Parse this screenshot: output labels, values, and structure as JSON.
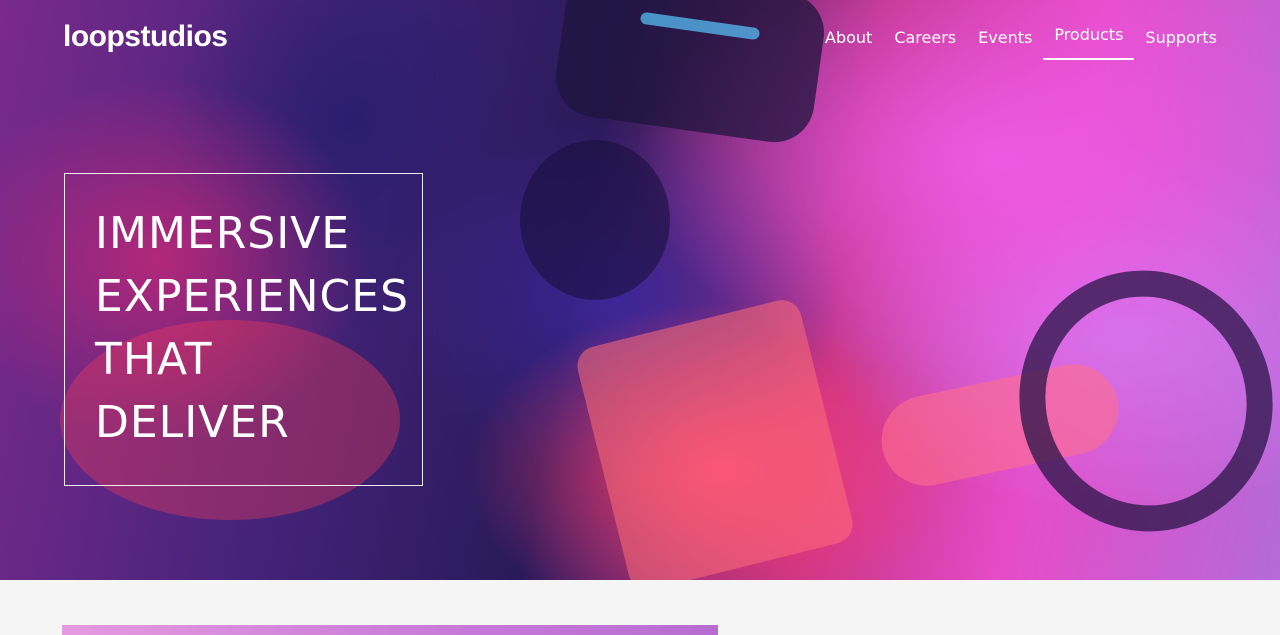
{
  "header": {
    "logo": "loopstudios",
    "nav": [
      {
        "label": "About",
        "active": false
      },
      {
        "label": "Careers",
        "active": false
      },
      {
        "label": "Events",
        "active": false
      },
      {
        "label": "Products",
        "active": true
      },
      {
        "label": "Supports",
        "active": false
      }
    ]
  },
  "hero": {
    "headline_lines": [
      "IMMERSIVE",
      "EXPERIENCES",
      "THAT",
      "DELIVER"
    ]
  },
  "colors": {
    "text": "#ffffff",
    "page_background": "#f5f5f5",
    "accent_magenta": "#e64cc8"
  }
}
